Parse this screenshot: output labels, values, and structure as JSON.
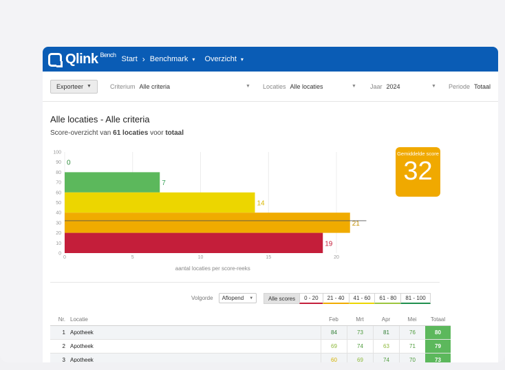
{
  "app": {
    "logo_text": "Qlink",
    "logo_sup": "Bench",
    "nav": [
      {
        "label": "Start"
      },
      {
        "label": "Benchmark"
      },
      {
        "label": "Overzicht"
      }
    ],
    "brand_color": "#0a5cb5"
  },
  "filters": {
    "export_label": "Exporteer",
    "criterium": {
      "label": "Criterium",
      "value": "Alle criteria"
    },
    "locaties": {
      "label": "Locaties",
      "value": "Alle locaties"
    },
    "jaar": {
      "label": "Jaar",
      "value": "2024"
    },
    "periode": {
      "label": "Periode",
      "value": "Totaal"
    }
  },
  "page": {
    "title": "Alle locaties - Alle criteria",
    "subtitle_pre": "Score-overzicht van ",
    "subtitle_bold": "61 locaties",
    "subtitle_mid": " voor ",
    "subtitle_bold2": "totaal"
  },
  "average": {
    "label": "Gemiddelde score",
    "value": "32",
    "color": "#f0a900"
  },
  "chart_data": {
    "type": "bar",
    "orientation": "horizontal",
    "categories": [
      "80-100",
      "60-80",
      "40-60",
      "20-40",
      "0-20"
    ],
    "values": [
      0,
      7,
      14,
      21,
      19
    ],
    "colors": [
      "#3aa35a",
      "#5cb85c",
      "#ecd600",
      "#f0ab00",
      "#c41e3a"
    ],
    "xlabel": "aantal locaties per score-reeks",
    "x_ticks": [
      0,
      5,
      10,
      15,
      20
    ],
    "y_ticks": [
      100,
      90,
      80,
      70,
      60,
      50,
      40,
      30,
      20,
      10,
      0
    ],
    "xlim": [
      0,
      25
    ],
    "ylim": [
      0,
      100
    ],
    "average_line": 32
  },
  "controls": {
    "sort_label": "Volgorde",
    "sort_value": "Aflopend",
    "ranges": [
      {
        "label": "Alle scores",
        "color": ""
      },
      {
        "label": "0 - 20",
        "color": "#c41e3a"
      },
      {
        "label": "21 - 40",
        "color": "#f0ab00"
      },
      {
        "label": "41 - 60",
        "color": "#ecd600"
      },
      {
        "label": "61 - 80",
        "color": "#9bc53d"
      },
      {
        "label": "81 - 100",
        "color": "#1f8f4e"
      }
    ]
  },
  "table": {
    "headers": {
      "nr": "Nr.",
      "loc": "Locatie",
      "feb": "Feb",
      "mrt": "Mrt",
      "apr": "Apr",
      "mei": "Mei",
      "tot": "Totaal"
    },
    "rows": [
      {
        "nr": "1",
        "loc": "Apotheek",
        "feb": "84",
        "mrt": "73",
        "apr": "81",
        "mei": "76",
        "tot": "80"
      },
      {
        "nr": "2",
        "loc": "Apotheek",
        "feb": "69",
        "mrt": "74",
        "apr": "63",
        "mei": "71",
        "tot": "79"
      },
      {
        "nr": "3",
        "loc": "Apotheek",
        "feb": "60",
        "mrt": "69",
        "apr": "74",
        "mei": "70",
        "tot": "73"
      }
    ]
  }
}
